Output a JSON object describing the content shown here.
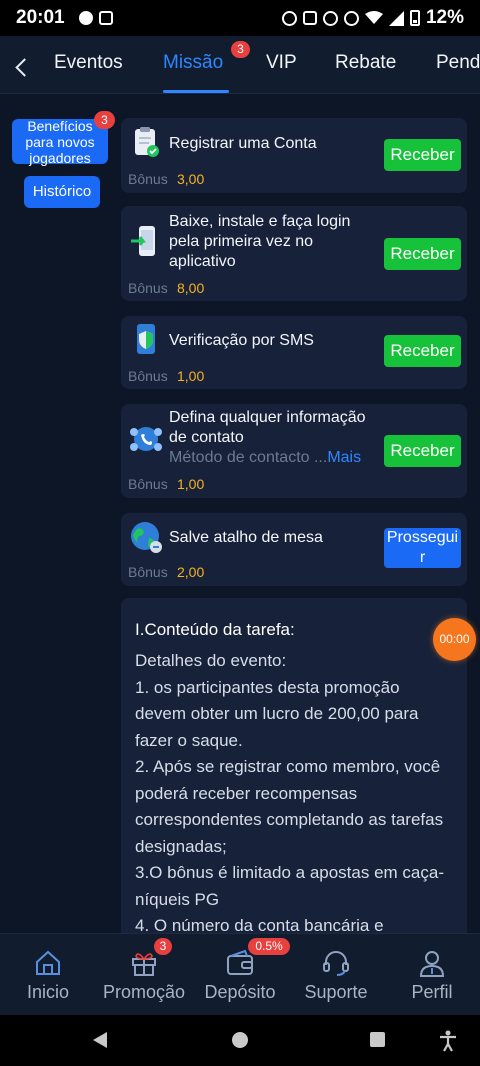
{
  "status_bar": {
    "time": "20:01",
    "battery": "12%"
  },
  "tabs": [
    {
      "label": "Eventos"
    },
    {
      "label": "Missão",
      "badge": "3"
    },
    {
      "label": "VIP"
    },
    {
      "label": "Rebate"
    },
    {
      "label": "Pend"
    }
  ],
  "sidebar": {
    "new_players": {
      "label": "Benefícios para novos jogadores",
      "badge": "3"
    },
    "history": {
      "label": "Histórico"
    }
  },
  "bonus_label": "Bônus",
  "missions": [
    {
      "title": "Registrar uma Conta",
      "bonus": "3,00",
      "button": "Receber"
    },
    {
      "title": "Baixe, instale e faça login pela primeira vez no aplicativo",
      "bonus": "8,00",
      "button": "Receber"
    },
    {
      "title": "Verificação por SMS",
      "bonus": "1,00",
      "button": "Receber"
    },
    {
      "title": "Defina qualquer informação de contato",
      "subtitle": "Método de contacto ...",
      "more": "Mais",
      "bonus": "1,00",
      "button": "Receber"
    },
    {
      "title": "Salve atalho de mesa",
      "bonus": "2,00",
      "button": "Prosseguir"
    }
  ],
  "details": {
    "heading": "I.Conteúdo da tarefa:",
    "lines": [
      "Detalhes do evento:",
      "1. os participantes desta promoção devem obter um lucro de 200,00 para fazer o saque.",
      "2. Após se registrar como membro, você poderá receber recompensas correspondentes completando as tarefas designadas;",
      "3.O bônus é limitado a apostas em caça-níqueis PG",
      "4. O número da conta bancária e"
    ]
  },
  "timer": "00:00",
  "bottom_nav": [
    {
      "label": "Inicio"
    },
    {
      "label": "Promoção",
      "badge": "3"
    },
    {
      "label": "Depósito",
      "badge": "0.5%"
    },
    {
      "label": "Suporte"
    },
    {
      "label": "Perfil"
    }
  ],
  "colors": {
    "accent": "#2f86ff",
    "receive": "#16c23a",
    "bonus": "#f6b21f",
    "badge": "#e8403f"
  }
}
